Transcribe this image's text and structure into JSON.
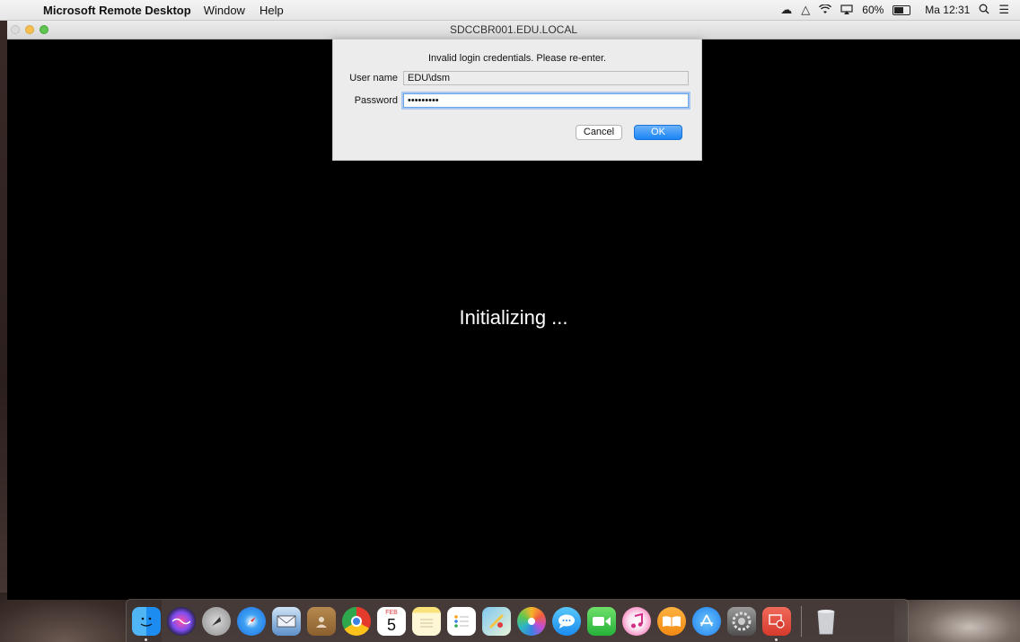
{
  "menubar": {
    "apple_icon": "apple-icon",
    "app_name": "Microsoft Remote Desktop",
    "menus": [
      "Window",
      "Help"
    ],
    "battery_percent": "60%",
    "clock": "Ma 12:31"
  },
  "window": {
    "title": "SDCCBR001.EDU.LOCAL",
    "status_text": "Initializing ..."
  },
  "dialog": {
    "message": "Invalid login credentials. Please re-enter.",
    "username_label": "User name",
    "username_value": "EDU\\dsm",
    "password_label": "Password",
    "password_value": "•••••••••",
    "cancel_label": "Cancel",
    "ok_label": "OK"
  },
  "dock": {
    "calendar_month": "FEB",
    "calendar_day": "5",
    "items": [
      "finder",
      "siri",
      "launchpad",
      "safari",
      "mail",
      "contacts",
      "chrome",
      "calendar",
      "notes",
      "reminders",
      "maps",
      "photos",
      "messages",
      "facetime",
      "itunes",
      "ibooks",
      "app-store",
      "system-preferences",
      "remote-desktop",
      "trash"
    ]
  },
  "colors": {
    "accent": "#1b84f5",
    "remote_background": "#000000"
  }
}
